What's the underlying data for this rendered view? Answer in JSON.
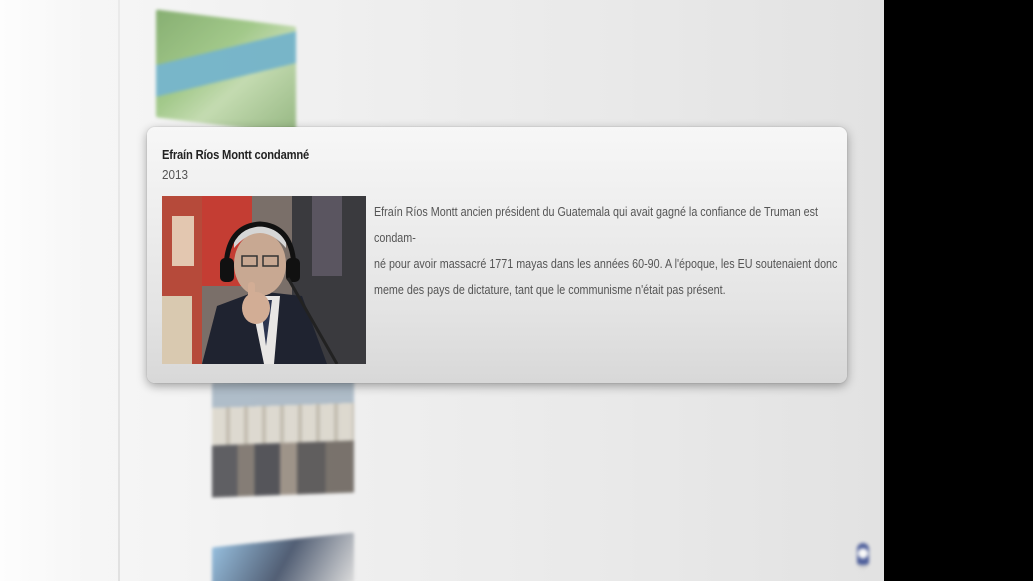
{
  "card": {
    "title": "Efraín Ríos Montt condamné",
    "year": "2013",
    "description": "Efraín Ríos Montt ancien président du Guatemala qui avait gagné la confiance de Truman est condam-né pour avoir massacré 1771 mayas dans les années 60-90. A l'époque, les EU soutenaient donc meme des pays de dictature, tant que le communisme n'était pas présent.",
    "lines": [
      "Efraín Ríos Montt ancien président du Guatemala qui avait gagné la confiance de Truman est condam-",
      "né pour avoir massacré 1771 mayas dans les années 60-90. A l'époque, les EU soutenaient donc",
      "meme des pays de dictature, tant que le communisme n'était pas présent."
    ],
    "photo_icon": "photo-efrain-rios-montt"
  },
  "colors": {
    "card_bg": "#efefef",
    "side_panel": "#000000"
  }
}
